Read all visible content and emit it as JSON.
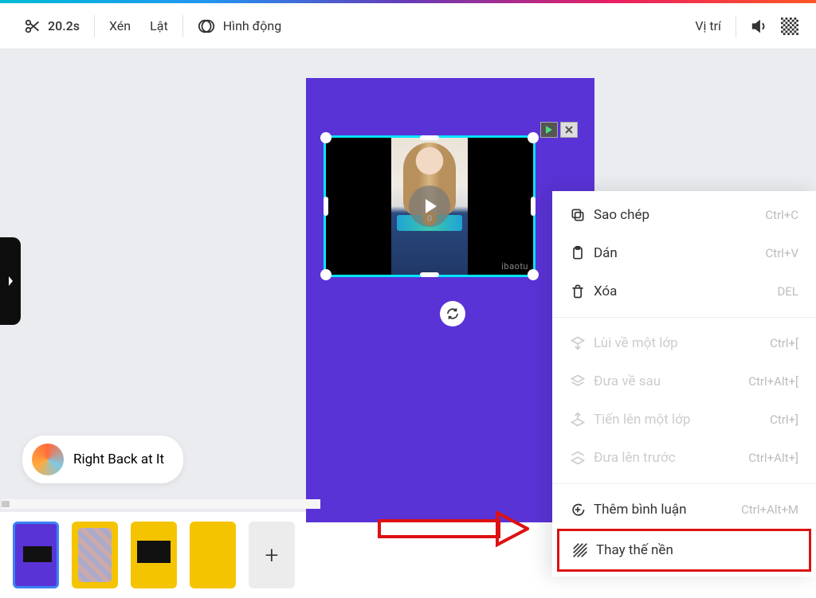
{
  "toolbar": {
    "duration": "20.2s",
    "crop": "Xén",
    "flip": "Lật",
    "animate": "Hình động",
    "position": "Vị trí"
  },
  "video": {
    "watermark": "ibaotu",
    "badge": "0"
  },
  "music": {
    "title": "Right Back at It"
  },
  "context_menu": {
    "copy": {
      "label": "Sao chép",
      "shortcut": "Ctrl+C"
    },
    "paste": {
      "label": "Dán",
      "shortcut": "Ctrl+V"
    },
    "delete": {
      "label": "Xóa",
      "shortcut": "DEL"
    },
    "backward": {
      "label": "Lùi về một lớp",
      "shortcut": "Ctrl+["
    },
    "to_back": {
      "label": "Đưa về sau",
      "shortcut": "Ctrl+Alt+["
    },
    "forward": {
      "label": "Tiến lên một lớp",
      "shortcut": "Ctrl+]"
    },
    "to_front": {
      "label": "Đưa lên trước",
      "shortcut": "Ctrl+Alt+]"
    },
    "comment": {
      "label": "Thêm bình luận",
      "shortcut": "Ctrl+Alt+M"
    },
    "replace_bg": {
      "label": "Thay thế nền"
    }
  },
  "colors": {
    "canvas_bg": "#5a33d6",
    "selection": "#00e5ff"
  }
}
